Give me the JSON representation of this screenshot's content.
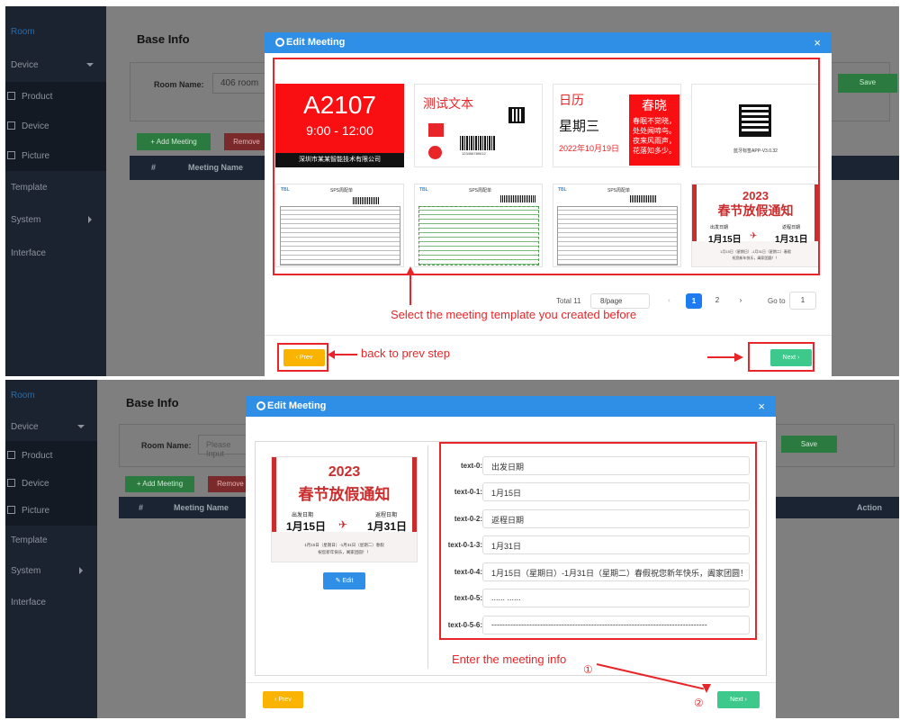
{
  "sidebar": {
    "room": "Room",
    "device_group": "Device",
    "product": "Product",
    "device": "Device",
    "picture": "Picture",
    "template": "Template",
    "system": "System",
    "interface": "Interface"
  },
  "page": {
    "title": "Base Info",
    "room_name_label": "Room Name:",
    "room_name_value": "406 room",
    "room_name_placeholder": "Please Input",
    "save": "Save",
    "add_meeting": "+ Add Meeting",
    "remove": "Remove",
    "col_index": "#",
    "col_meeting_name": "Meeting Name",
    "col_action": "Action"
  },
  "modal": {
    "title": "Edit Meeting",
    "close": "×",
    "prev": "‹ Prev",
    "next": "Next ›",
    "edit": "Edit"
  },
  "templates": {
    "room_no": "A2107",
    "time": "9:00 - 12:00",
    "company": "深圳市某某智能技术有限公司",
    "test_text": "测试文本",
    "barcode_number": "123456789012",
    "calendar": "日历",
    "weekday": "星期三",
    "date": "2022年10月19日",
    "poem_title": "春晓",
    "poem_lines": [
      "春眠不觉晓，",
      "处处闻啼鸟。",
      "夜来风雨声，",
      "花落知多少。"
    ],
    "qr_caption": "蓝牙标签APP-V3.0.32",
    "sps_logo": "TBL",
    "sps_title": "SPS周配单",
    "holiday_year": "2023",
    "holiday_title": "春节放假通知",
    "holiday_from_label": "出发日期",
    "holiday_to_label": "返程日期",
    "holiday_from": "1月15日",
    "holiday_to": "1月31日",
    "holiday_note_1": "1月15日（星期日）-1月31日（星期二）春假",
    "holiday_note_2": "祝您新年快乐，阖家团圆！！"
  },
  "pagination": {
    "total": "Total 11",
    "per_page": "8/page",
    "pages": [
      "1",
      "2"
    ],
    "goto_label": "Go to",
    "goto_value": "1"
  },
  "fields": [
    {
      "label": "text-0:",
      "value": "出发日期"
    },
    {
      "label": "text-0-1:",
      "value": "1月15日"
    },
    {
      "label": "text-0-2:",
      "value": "返程日期"
    },
    {
      "label": "text-0-1-3:",
      "value": "1月31日"
    },
    {
      "label": "text-0-4:",
      "value": "1月15日（星期日）-1月31日（星期二）春假祝您新年快乐，阖家团圆！！"
    },
    {
      "label": "text-0-5:",
      "value": "...... ......"
    },
    {
      "label": "text-0-5-6:",
      "value": "--------------------------------------------------------------------------------"
    }
  ],
  "annotations": {
    "select_template": "Select the meeting template you created before",
    "back": "back to prev step",
    "enter_info": "Enter the meeting info",
    "step1": "①",
    "step2": "②"
  },
  "colors": {
    "accent": "#2f8fe6",
    "annotation": "#e8262a",
    "next": "#3cc98b",
    "prev": "#fab400"
  }
}
